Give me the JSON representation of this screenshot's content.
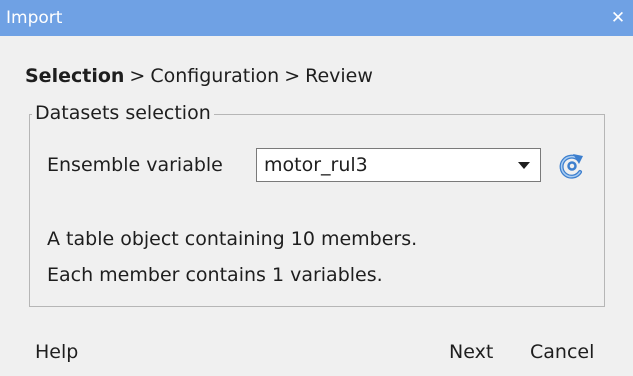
{
  "window": {
    "title": "Import",
    "close_glyph": "✕"
  },
  "breadcrumb": {
    "current": "Selection",
    "steps": [
      "Configuration",
      "Review"
    ],
    "separator": ">"
  },
  "datasets_group": {
    "label": "Datasets selection",
    "ensemble_label": "Ensemble variable",
    "ensemble_value": "motor_rul3",
    "refresh_icon": "refresh-icon",
    "info_lines": [
      "A table object containing 10 members.",
      "Each member contains 1 variables."
    ]
  },
  "footer": {
    "help_label": "Help",
    "next_label": "Next",
    "cancel_label": "Cancel"
  },
  "colors": {
    "titlebar": "#6fa1e4",
    "background": "#f0f0f0",
    "refresh_icon": "#3d7fce"
  }
}
